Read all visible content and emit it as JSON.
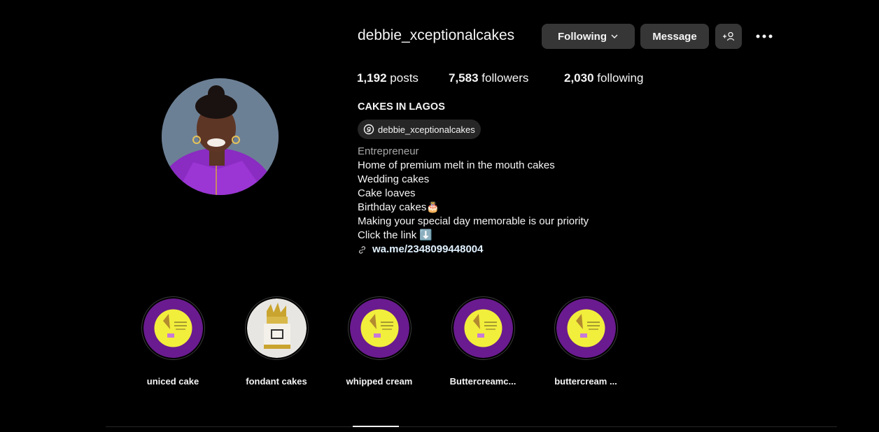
{
  "profile": {
    "username": "debbie_xceptionalcakes",
    "following_btn": "Following",
    "message_btn": "Message",
    "stats": {
      "posts_count": "1,192",
      "posts_label": "posts",
      "followers_count": "7,583",
      "followers_label": "followers",
      "following_count": "2,030",
      "following_label": "following"
    },
    "name": "CAKES IN LAGOS",
    "threads_handle": "debbie_xceptionalcakes",
    "bio": {
      "category": "Entrepreneur",
      "lines": [
        "Home of premium melt in the mouth cakes",
        "Wedding cakes",
        "Cake loaves",
        "Birthday cakes🎂",
        "Making your special day memorable is our priority",
        "Click the link ⬇️"
      ],
      "link": "wa.me/2348099448004"
    }
  },
  "highlights": [
    {
      "label": "uniced cake"
    },
    {
      "label": "fondant cakes"
    },
    {
      "label": "whipped cream"
    },
    {
      "label": "Buttercreamc..."
    },
    {
      "label": "buttercream ..."
    }
  ],
  "colors": {
    "background": "#000000",
    "button": "#363636",
    "highlight_purple": "#6a1b8f",
    "highlight_yellow": "#f2ee3c"
  }
}
